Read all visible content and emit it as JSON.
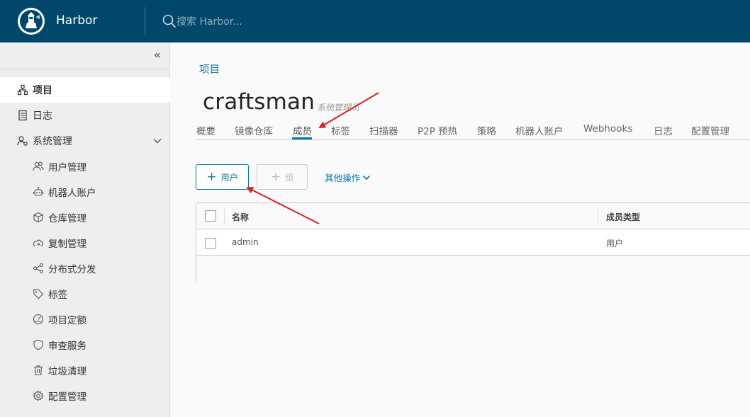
{
  "header": {
    "brand": "Harbor",
    "search_placeholder": "搜索 Harbor..."
  },
  "sidebar": {
    "items": [
      {
        "label": "项目",
        "icon": "project-icon",
        "active": true
      },
      {
        "label": "日志",
        "icon": "log-icon"
      },
      {
        "label": "系统管理",
        "icon": "admin-icon",
        "expanded": true
      },
      {
        "label": "用户管理",
        "icon": "users-icon"
      },
      {
        "label": "机器人账户",
        "icon": "robot-icon"
      },
      {
        "label": "仓库管理",
        "icon": "registry-icon"
      },
      {
        "label": "复制管理",
        "icon": "replication-icon"
      },
      {
        "label": "分布式分发",
        "icon": "share-icon"
      },
      {
        "label": "标签",
        "icon": "tag-icon"
      },
      {
        "label": "项目定额",
        "icon": "quota-icon"
      },
      {
        "label": "审查服务",
        "icon": "shield-icon"
      },
      {
        "label": "垃圾清理",
        "icon": "trash-icon"
      },
      {
        "label": "配置管理",
        "icon": "gear-icon"
      }
    ]
  },
  "main": {
    "breadcrumb": "项目",
    "title": "craftsman",
    "role": "系统管理员",
    "tabs": [
      "概要",
      "镜像仓库",
      "成员",
      "标签",
      "扫描器",
      "P2P 预热",
      "策略",
      "机器人账户",
      "Webhooks",
      "日志",
      "配置管理"
    ],
    "active_tab": "成员",
    "buttons": {
      "add_user": "用户",
      "add_group": "组",
      "more": "其他操作"
    },
    "table": {
      "columns": [
        "名称",
        "成员类型"
      ],
      "rows": [
        {
          "name": "admin",
          "type": "用户"
        }
      ]
    }
  },
  "colors": {
    "header_bg": "#00486b",
    "accent": "#0079a8",
    "annotation_arrow": "#e02020"
  }
}
